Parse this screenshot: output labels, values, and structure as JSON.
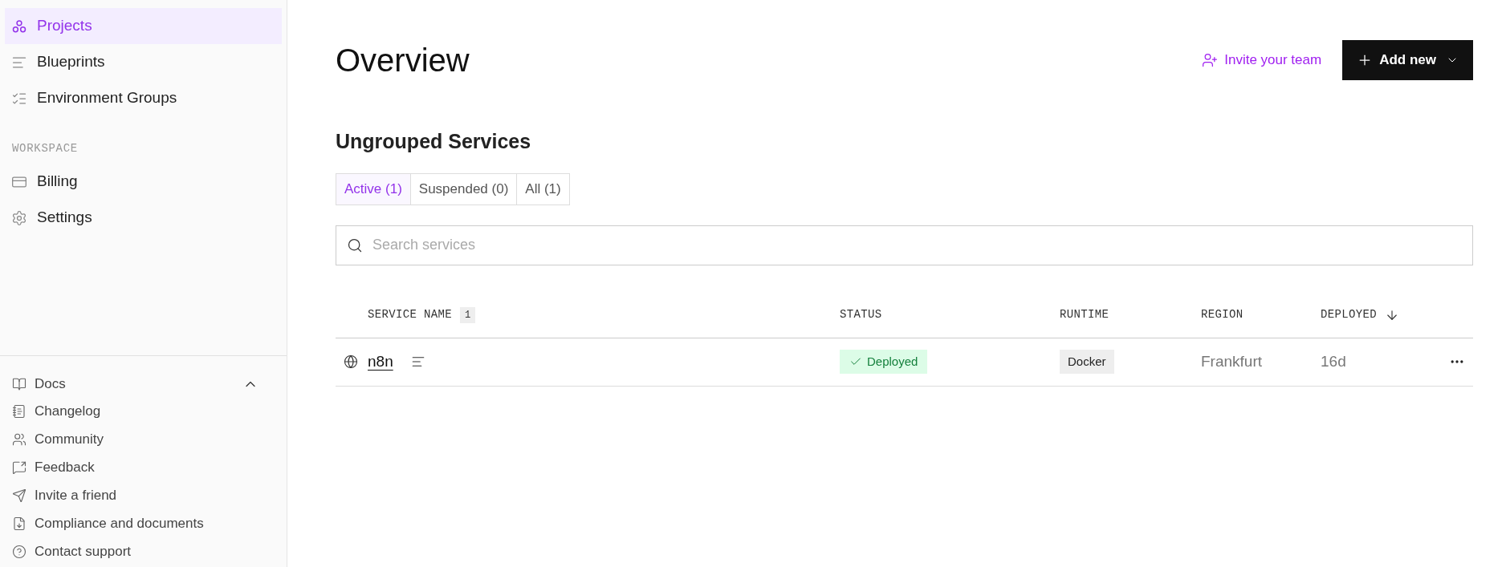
{
  "sidebar": {
    "nav": [
      {
        "label": "Projects",
        "selected": true
      },
      {
        "label": "Blueprints",
        "selected": false
      },
      {
        "label": "Environment Groups",
        "selected": false
      }
    ],
    "workspace": {
      "heading": "WORKSPACE",
      "items": [
        {
          "label": "Billing",
          "selected": false
        },
        {
          "label": "Settings",
          "selected": false
        }
      ]
    },
    "footer": {
      "docs": {
        "label": "Docs",
        "expanded": true
      },
      "items": [
        {
          "label": "Changelog"
        },
        {
          "label": "Community"
        },
        {
          "label": "Feedback"
        },
        {
          "label": "Invite a friend"
        },
        {
          "label": "Compliance and documents"
        },
        {
          "label": "Contact support"
        }
      ]
    }
  },
  "header": {
    "title": "Overview",
    "invite_button": "Invite your team",
    "add_button": "Add new"
  },
  "section": {
    "title": "Ungrouped Services",
    "tabs": [
      {
        "label": "Active (1)",
        "selected": true
      },
      {
        "label": "Suspended (0)",
        "selected": false
      },
      {
        "label": "All (1)",
        "selected": false
      }
    ],
    "search": {
      "placeholder": "Search services"
    },
    "table": {
      "columns": [
        {
          "label": "SERVICE NAME",
          "count": "1",
          "sorted": false
        },
        {
          "label": "STATUS",
          "sorted": false
        },
        {
          "label": "RUNTIME",
          "sorted": false
        },
        {
          "label": "REGION",
          "sorted": false
        },
        {
          "label": "DEPLOYED",
          "sorted": true
        }
      ],
      "rows": [
        {
          "name": "n8n",
          "status": "Deployed",
          "runtime": "Docker",
          "region": "Frankfurt",
          "deployed": "16d"
        }
      ]
    }
  }
}
